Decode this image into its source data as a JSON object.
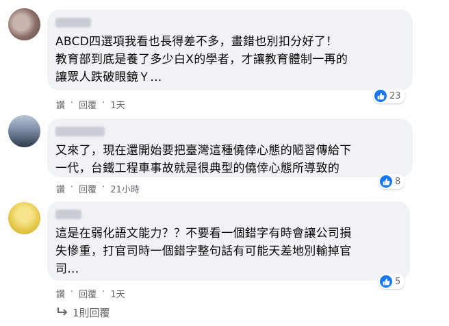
{
  "comments": [
    {
      "lines": [
        "ABCD四選項我看也長得差不多，畫錯也別扣分好了！",
        "教育部到底是養了多少白X的學者，才讓教育體制一再的",
        "讓眾人跌破眼鏡Ｙ..."
      ],
      "reactions": "23",
      "actions": {
        "like": "讚",
        "reply": "回覆",
        "time": "1天"
      }
    },
    {
      "lines": [
        "又來了，現在還開始要把臺灣這種僥倖心態的陋習傳給下",
        "一代，台鐵工程車事故就是很典型的僥倖心態所導致的"
      ],
      "reactions": "8",
      "actions": {
        "like": "讚",
        "reply": "回覆",
        "time": "21小時"
      }
    },
    {
      "lines": [
        "這是在弱化語文能力？？不要看一個錯字有時會讓公司損",
        "失慘重，打官司時一個錯字整句話有可能天差地別輸掉官",
        "司..."
      ],
      "reactions": "5",
      "actions": {
        "like": "讚",
        "reply": "回覆",
        "time": "1天"
      }
    }
  ],
  "replies_link": "1則回覆",
  "icons": {
    "like": "thumbs-up-icon",
    "reply_arrow": "reply-arrow-icon"
  },
  "colors": {
    "bubble": "#f0f2f5",
    "like_blue": "#1877f2",
    "meta_text": "#65676b"
  }
}
